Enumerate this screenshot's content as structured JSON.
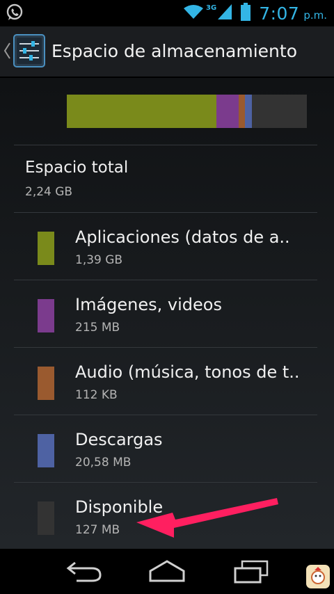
{
  "status_bar": {
    "time": "7:07",
    "ampm": "p.m.",
    "network": "3G",
    "icons": [
      "whatsapp-icon",
      "wifi-icon",
      "signal-icon",
      "battery-icon"
    ]
  },
  "action_bar": {
    "title": "Espacio de almacenamiento",
    "icons": [
      "up-caret-icon",
      "settings-sliders-icon"
    ]
  },
  "storage": {
    "total_label": "Espacio total",
    "total_value": "2,24 GB",
    "items": [
      {
        "label": "Aplicaciones (datos de a..",
        "value": "1,39 GB",
        "color": "#7a8a1b"
      },
      {
        "label": "Imágenes, videos",
        "value": "215 MB",
        "color": "#7b3b8d"
      },
      {
        "label": "Audio (música, tonos de t..",
        "value": "112 KB",
        "color": "#9a5a2f"
      },
      {
        "label": "Descargas",
        "value": "20,58 MB",
        "color": "#4e62a3"
      },
      {
        "label": "Disponible",
        "value": "127 MB",
        "color": "#333333"
      }
    ]
  },
  "usage_bar": {
    "segments": [
      {
        "name": "Aplicaciones",
        "fraction": 0.622,
        "color": "#7a8a1b"
      },
      {
        "name": "Imágenes, videos",
        "fraction": 0.093,
        "color": "#7b3b8d"
      },
      {
        "name": "Audio",
        "fraction": 0.026,
        "color": "#9a5a2f"
      },
      {
        "name": "Descargas",
        "fraction": 0.029,
        "color": "#4e62a3"
      },
      {
        "name": "Disponible",
        "fraction": 0.23,
        "color": "#333333"
      }
    ]
  },
  "annotation": {
    "arrow_color": "#ff2266",
    "icon": "pointer-arrow-icon"
  },
  "nav_bar": {
    "icons": [
      "back-icon",
      "home-icon",
      "recent-apps-icon",
      "app-shortcut-icon"
    ]
  }
}
